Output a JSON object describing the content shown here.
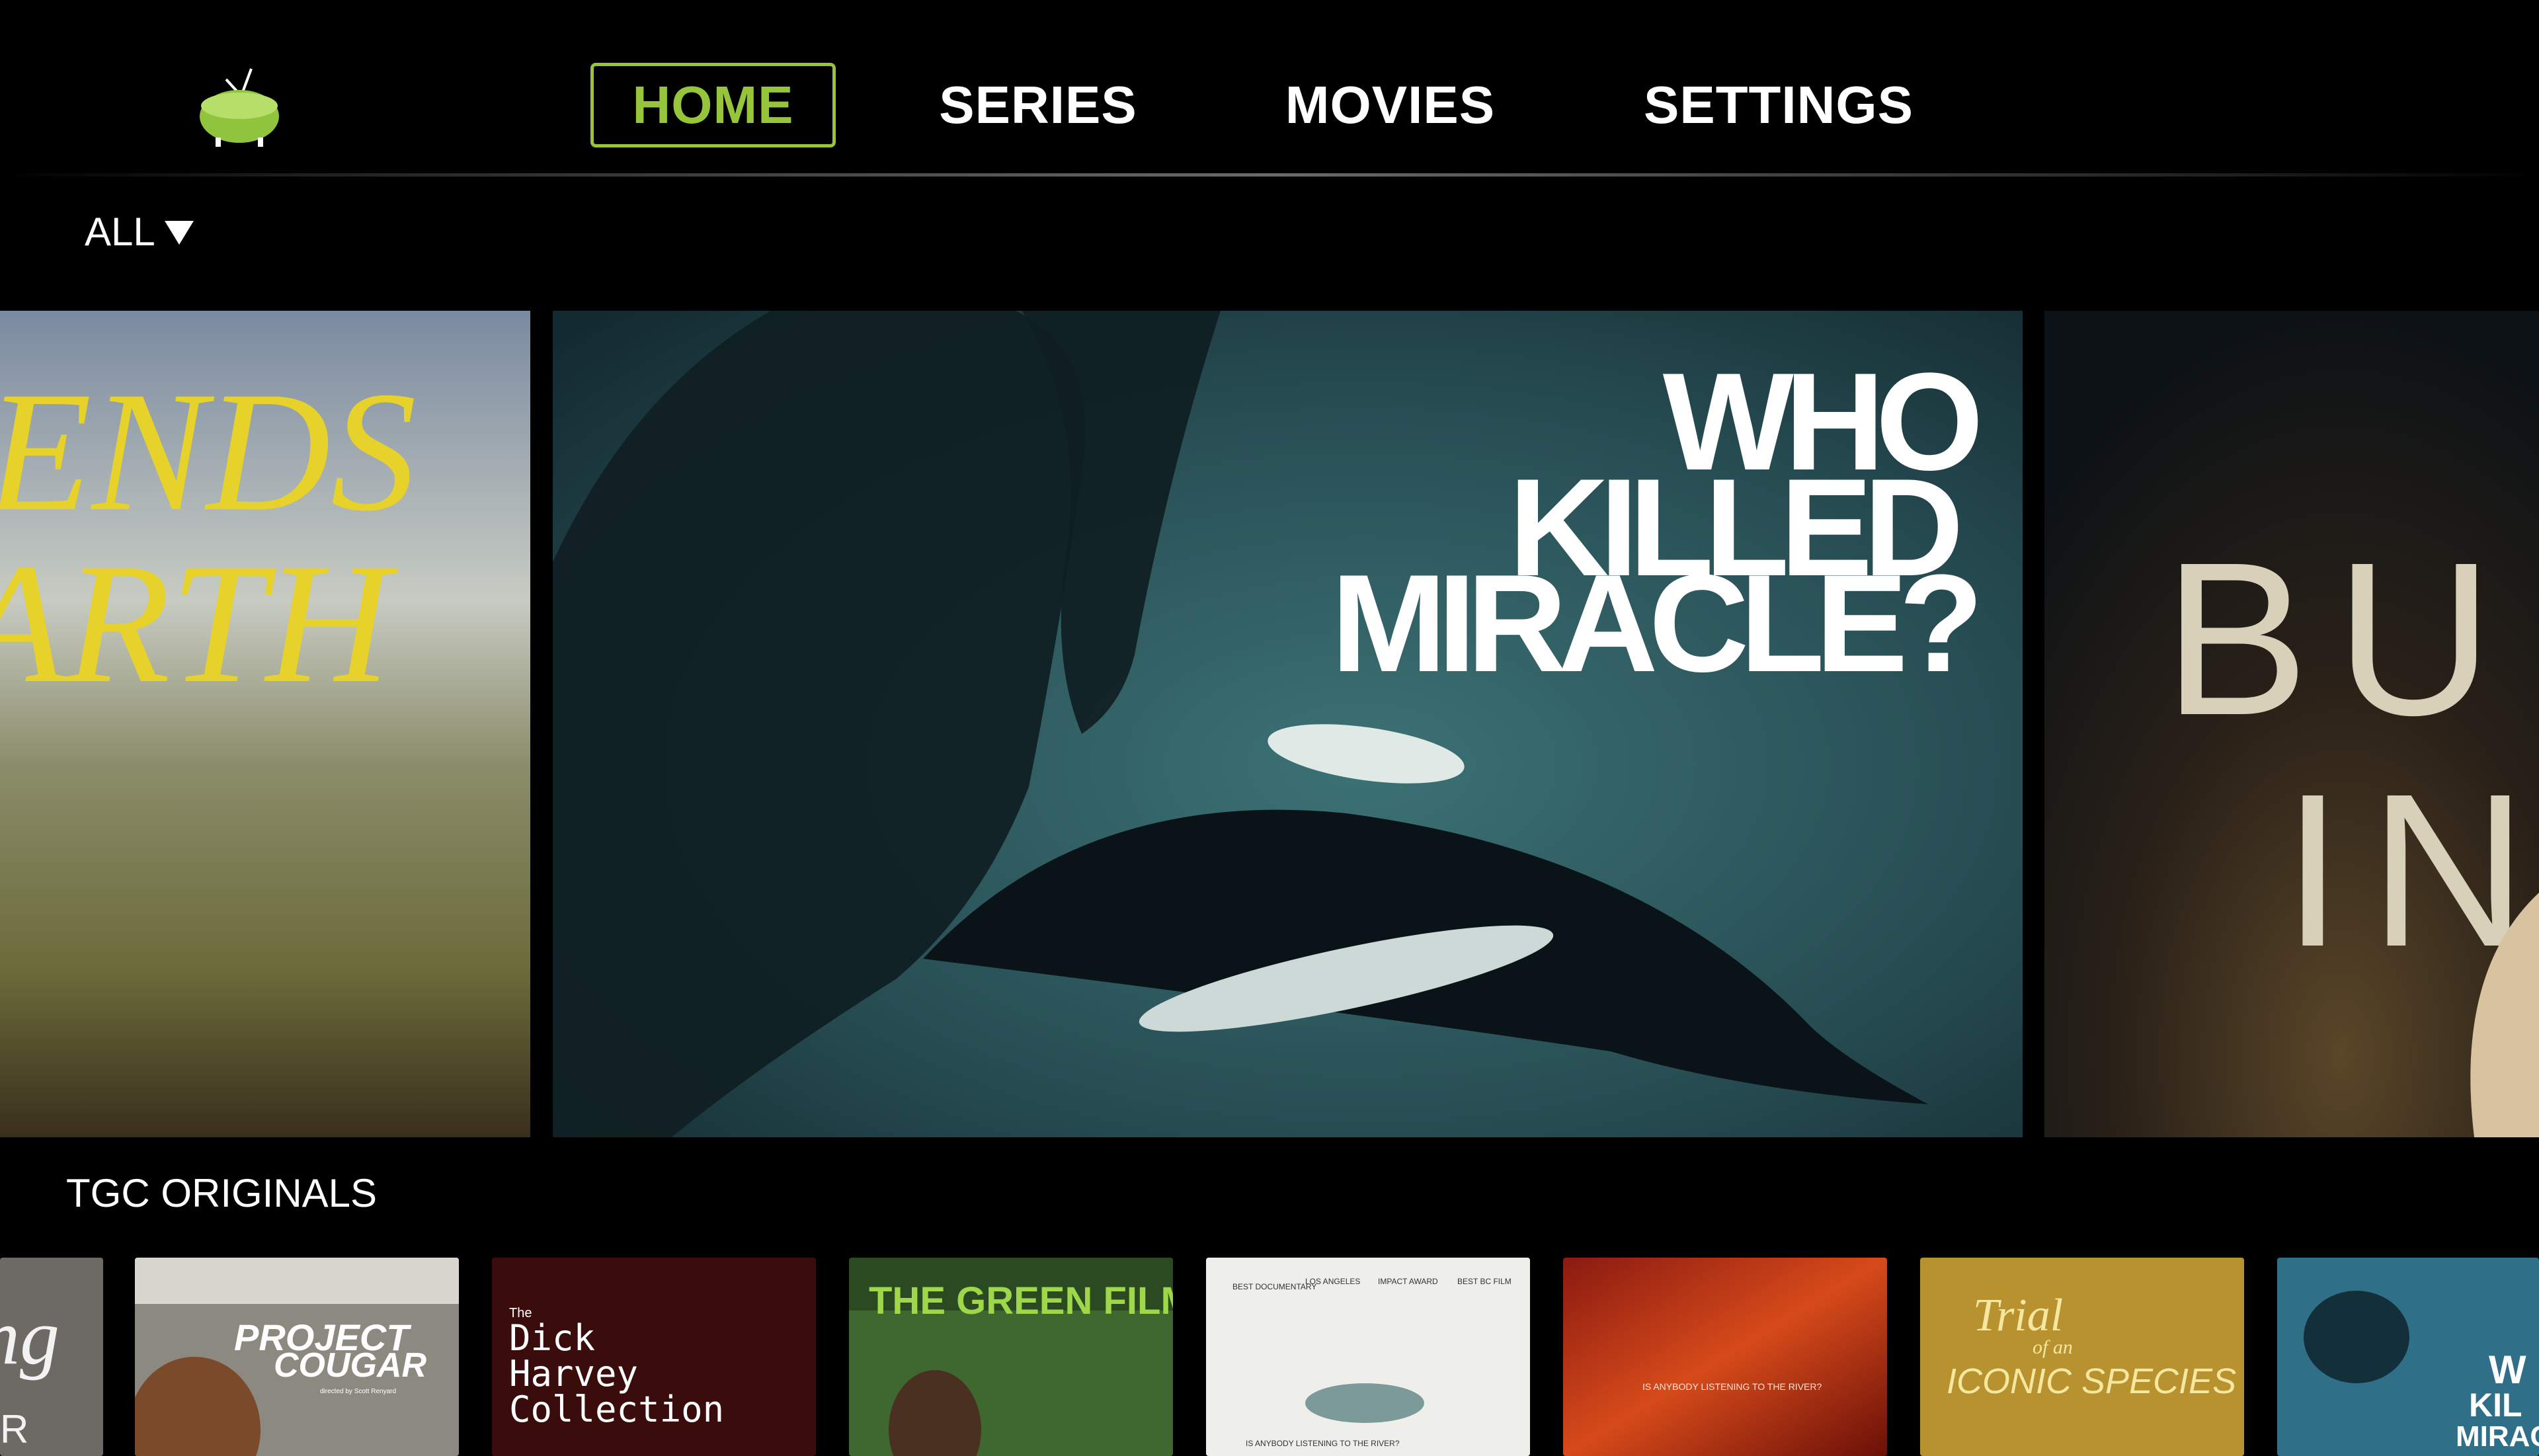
{
  "nav": {
    "logo_icon": "tv-icon",
    "tabs": [
      {
        "label": "HOME",
        "active": true
      },
      {
        "label": "SERIES",
        "active": false
      },
      {
        "label": "MOVIES",
        "active": false
      },
      {
        "label": "SETTINGS",
        "active": false
      }
    ]
  },
  "filter": {
    "label": "ALL"
  },
  "hero": {
    "left_card": {
      "title_lines": [
        "ENDS",
        "ARTH"
      ]
    },
    "center_card": {
      "title_lines": [
        "WHO",
        "KILLED",
        "MIRACLE?"
      ]
    },
    "right_card": {
      "title_lines": [
        "BU",
        "IN"
      ]
    }
  },
  "section": {
    "title": "TGC ORIGINALS",
    "posters": [
      {
        "title": "ng",
        "subtitle": "R"
      },
      {
        "title": "PROJECT",
        "subtitle": "COUGAR",
        "caption": "directed by Scott Renyard"
      },
      {
        "small": "The",
        "title": "Dick",
        "line2": "Harvey",
        "line3": "Collection"
      },
      {
        "title": "THE GREEN FILM"
      },
      {
        "title": "IS ANYBODY LISTENING TO THE RIVER?",
        "laurels": [
          "BEST DOCUMENTARY",
          "LOS ANGELES",
          "IMPACT AWARD",
          "BEST BC FILM"
        ]
      },
      {
        "title": "IS ANYBODY LISTENING TO THE RIVER?"
      },
      {
        "title": "Trial",
        "line2": "of an",
        "line3": "ICONIC SPECIES"
      },
      {
        "title": "W",
        "line2": "KIL",
        "line3": "MIRAC"
      }
    ]
  },
  "colors": {
    "accent": "#96c43a",
    "background": "#000000"
  }
}
